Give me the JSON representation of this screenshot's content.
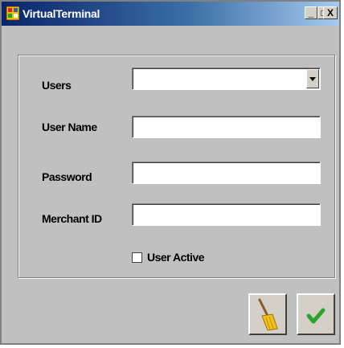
{
  "window": {
    "title": "VirtualTerminal",
    "minimize_label": "_",
    "maximize_label": "□",
    "close_label": "X"
  },
  "form": {
    "users_label": "Users",
    "users_value": "",
    "username_label": "User Name",
    "username_value": "",
    "password_label": "Password",
    "password_value": "",
    "merchant_label": "Merchant ID",
    "merchant_value": "",
    "user_active_label": "User Active",
    "user_active_checked": false
  },
  "buttons": {
    "clear_icon": "broom-icon",
    "confirm_icon": "checkmark-icon"
  },
  "colors": {
    "title_gradient_start": "#0a246a",
    "title_gradient_end": "#a6caf0",
    "window_bg": "#c0c0c0",
    "check_green": "#2aa52a"
  }
}
